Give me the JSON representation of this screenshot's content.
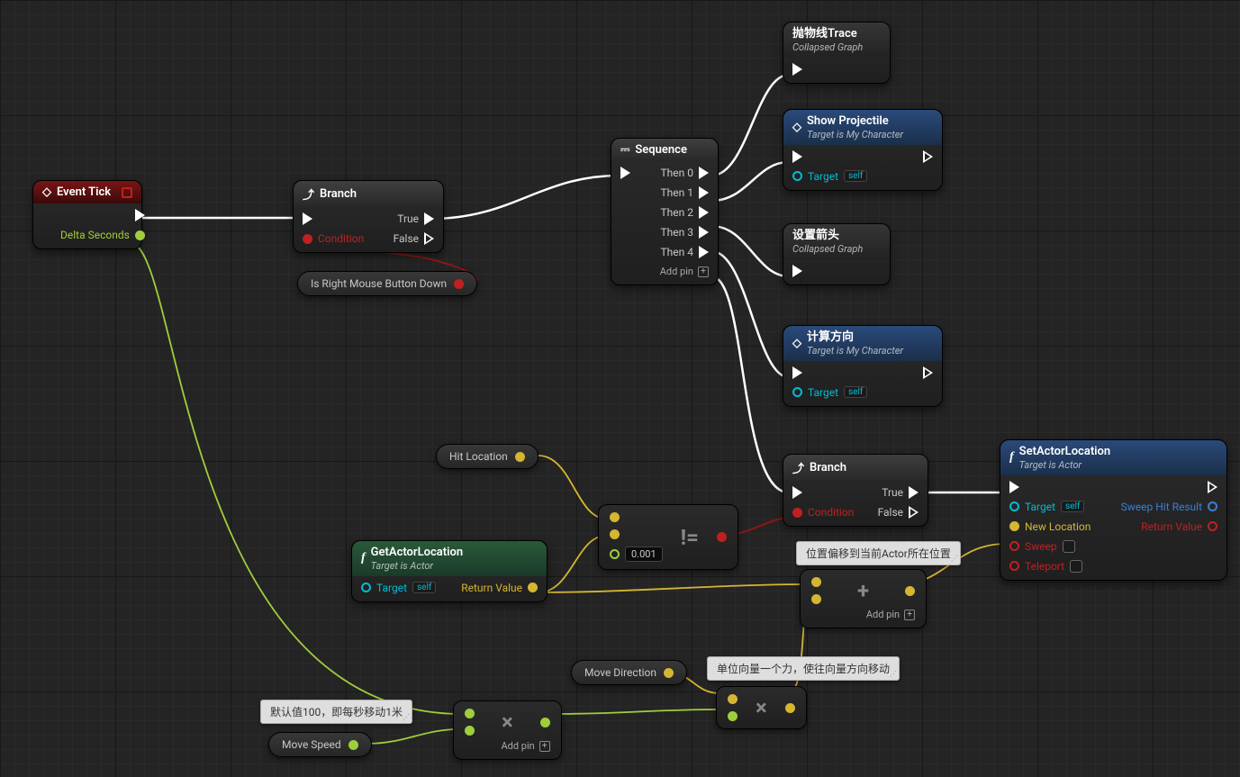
{
  "nodes": {
    "eventTick": {
      "title": "Event Tick",
      "pin_delta": "Delta Seconds"
    },
    "branch1": {
      "title": "Branch",
      "pin_cond": "Condition",
      "pin_true": "True",
      "pin_false": "False"
    },
    "isRightMouse": {
      "label": "Is Right Mouse Button Down"
    },
    "sequence": {
      "title": "Sequence",
      "then0": "Then 0",
      "then1": "Then 1",
      "then2": "Then 2",
      "then3": "Then 3",
      "then4": "Then 4",
      "addpin": "Add pin"
    },
    "trace": {
      "title": "抛物线Trace",
      "sub": "Collapsed Graph"
    },
    "showProjectile": {
      "title": "Show Projectile",
      "sub": "Target is My Character",
      "pin_target": "Target",
      "self": "self"
    },
    "setArrow": {
      "title": "设置箭头",
      "sub": "Collapsed Graph"
    },
    "calcDir": {
      "title": "计算方向",
      "sub": "Target is My Character",
      "pin_target": "Target",
      "self": "self"
    },
    "hitLocation": {
      "label": "Hit Location"
    },
    "getActorLocation": {
      "title": "GetActorLocation",
      "sub": "Target is Actor",
      "pin_target": "Target",
      "self": "self",
      "pin_return": "Return Value"
    },
    "notEqual": {
      "icon": "!=",
      "tolerance": "0.001"
    },
    "branch2": {
      "title": "Branch",
      "pin_cond": "Condition",
      "pin_true": "True",
      "pin_false": "False"
    },
    "setActorLocation": {
      "title": "SetActorLocation",
      "sub": "Target is Actor",
      "pin_target": "Target",
      "self": "self",
      "pin_newloc": "New Location",
      "pin_sweep": "Sweep",
      "pin_teleport": "Teleport",
      "pin_sweephit": "Sweep Hit Result",
      "pin_return": "Return Value"
    },
    "moveDirection": {
      "label": "Move Direction"
    },
    "moveSpeed": {
      "label": "Move Speed"
    },
    "multiply": {
      "icon": "×",
      "addpin": "Add pin"
    },
    "multiply2": {
      "icon": "×"
    },
    "add": {
      "icon": "+",
      "addpin": "Add pin"
    }
  },
  "comments": {
    "offset": "位置偏移到当前Actor所在位置",
    "unitForce": "单位向量一个力，使往向量方向移动",
    "default100": "默认值100，即每秒移动1米"
  }
}
